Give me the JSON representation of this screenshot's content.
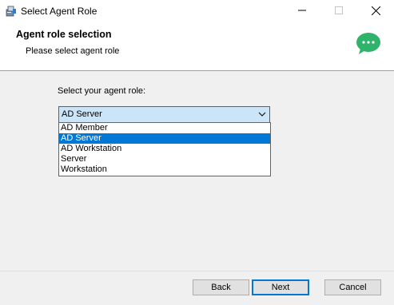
{
  "window": {
    "title": "Select Agent Role",
    "icons": {
      "app": "installer-icon",
      "minimize": "minimize-icon",
      "maximize": "maximize-icon",
      "close": "close-icon"
    }
  },
  "banner": {
    "title": "Agent role selection",
    "subtitle": "Please select agent role",
    "icon": "chat-bubble-icon",
    "icon_color": "#2fb36b"
  },
  "form": {
    "prompt": "Select your agent role:",
    "selected": "AD Server",
    "options": [
      "AD Member",
      "AD Server",
      "AD Workstation",
      "Server",
      "Workstation"
    ],
    "highlight_color": "#0078d7"
  },
  "buttons": {
    "back": "Back",
    "next": "Next",
    "cancel": "Cancel"
  }
}
